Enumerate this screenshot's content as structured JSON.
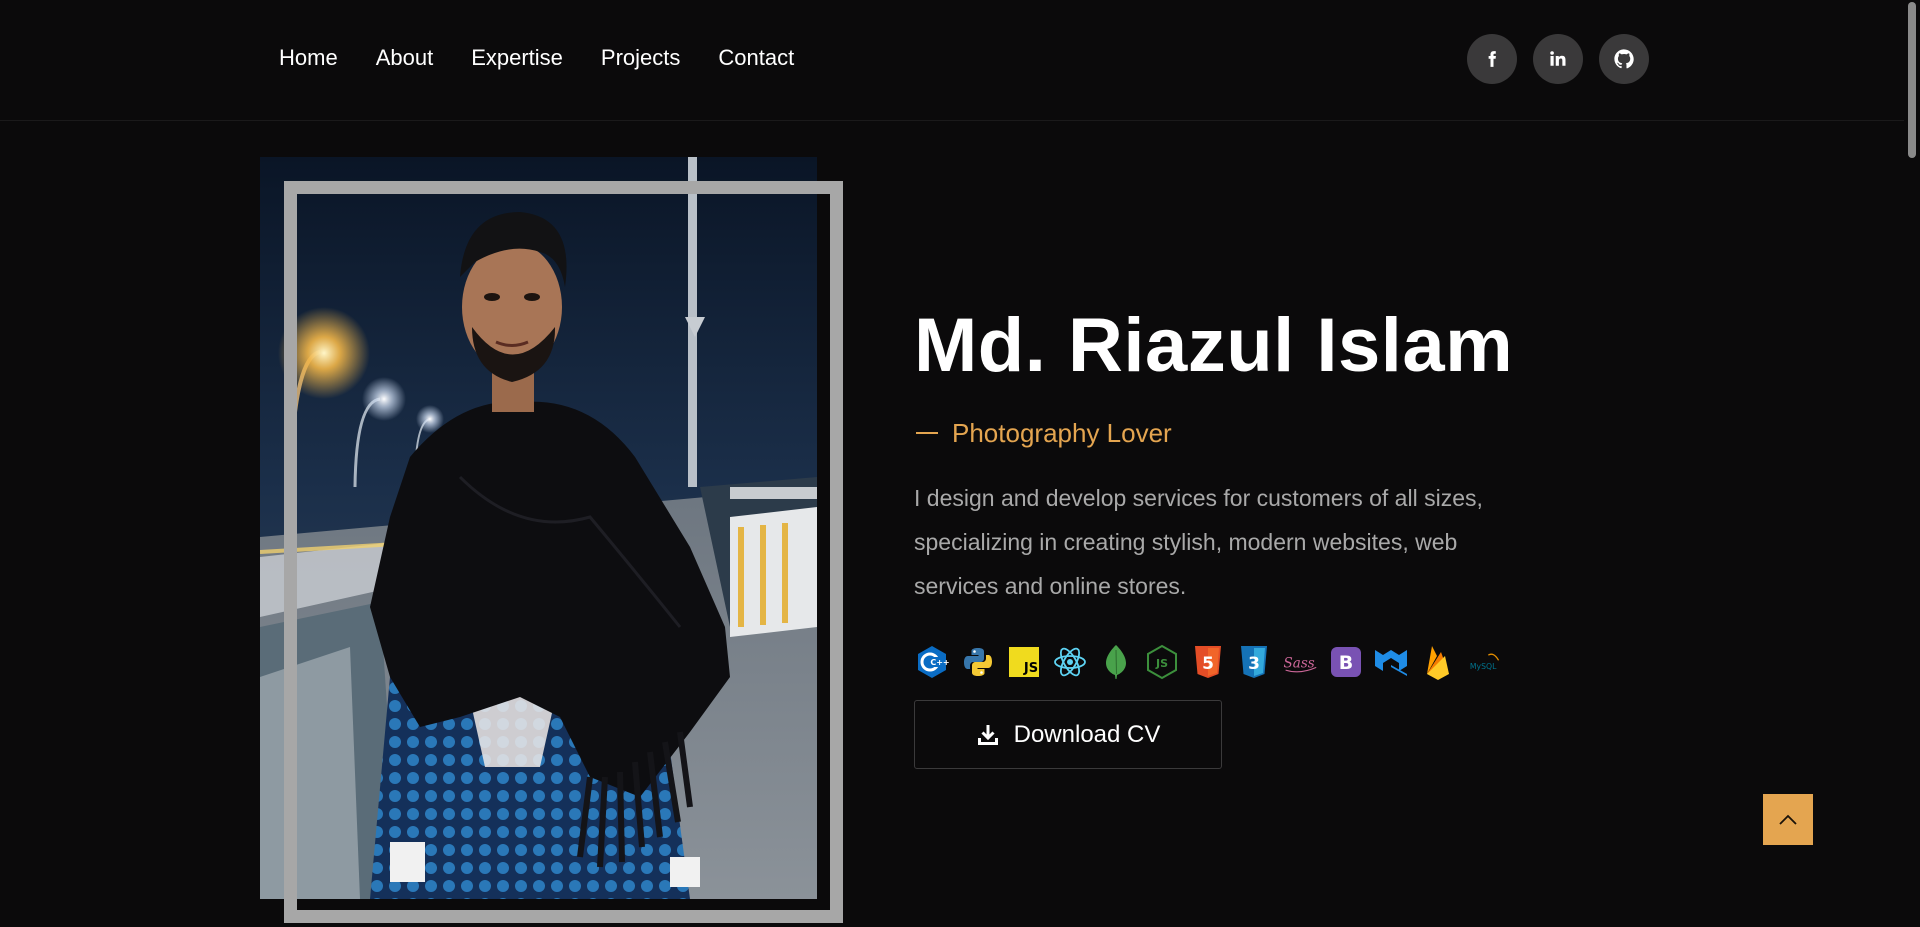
{
  "nav": {
    "items": [
      {
        "label": "Home"
      },
      {
        "label": "About"
      },
      {
        "label": "Expertise"
      },
      {
        "label": "Projects"
      },
      {
        "label": "Contact"
      }
    ]
  },
  "socials": [
    {
      "icon": "facebook-icon"
    },
    {
      "icon": "linkedin-icon"
    },
    {
      "icon": "github-icon"
    }
  ],
  "hero": {
    "name": "Md. Riazul Islam",
    "tagline": "Photography Lover",
    "bio": "I design and develop services for customers of all sizes, specializing in creating stylish, modern websites, web services and online stores.",
    "tech_icons": [
      {
        "icon": "cpp-icon",
        "text": "C++"
      },
      {
        "icon": "python-icon"
      },
      {
        "icon": "javascript-icon",
        "text": "JS"
      },
      {
        "icon": "react-icon"
      },
      {
        "icon": "mongodb-icon"
      },
      {
        "icon": "nodejs-icon",
        "text": "JS"
      },
      {
        "icon": "html5-icon",
        "text": "5"
      },
      {
        "icon": "css3-icon",
        "text": "3"
      },
      {
        "icon": "sass-icon",
        "text": "Sass"
      },
      {
        "icon": "bootstrap-icon",
        "text": "B"
      },
      {
        "icon": "material-ui-icon"
      },
      {
        "icon": "firebase-icon"
      },
      {
        "icon": "mysql-icon",
        "text": "MySQL"
      }
    ],
    "download_label": "Download CV"
  },
  "colors": {
    "background": "#0b0a0b",
    "accent": "#e4a550",
    "social_bg": "#3a393a",
    "frame": "#a7a7a7",
    "body_text": "#a9a9a9"
  }
}
